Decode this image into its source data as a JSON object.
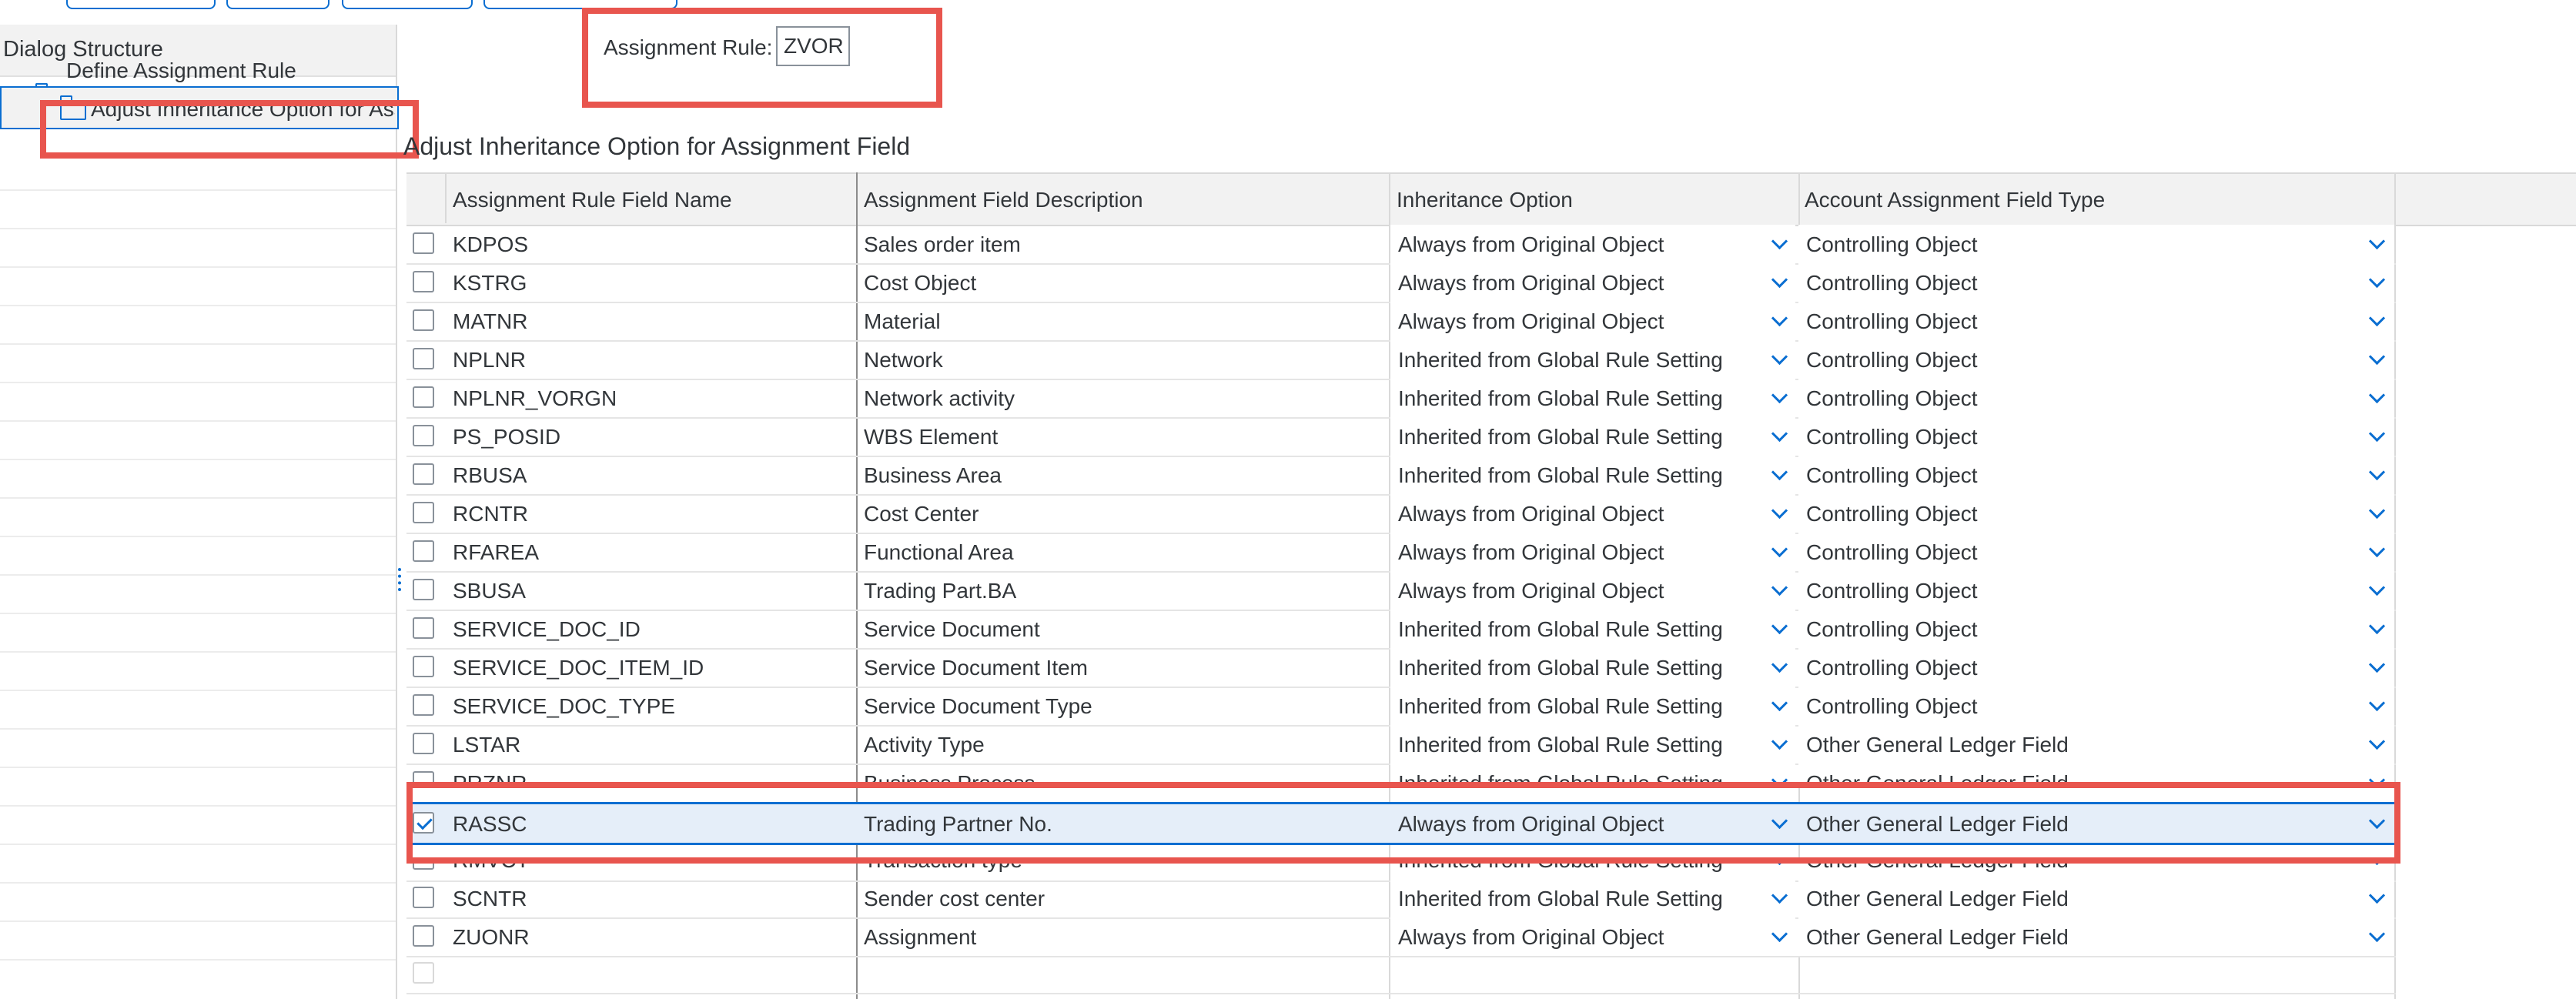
{
  "dialog": {
    "title": "Dialog Structure"
  },
  "tree": {
    "item1": "Define Assignment Rule",
    "item2": "Adjust Inheritance Option for Ass"
  },
  "assignment_rule": {
    "label": "Assignment Rule:",
    "value": "ZVOR"
  },
  "section_title": "Adjust Inheritance Option for Assignment Field",
  "table": {
    "headers": [
      "Assignment Rule Field Name",
      "Assignment Field Description",
      "Inheritance Option",
      "Account Assignment Field Type"
    ],
    "rows": [
      {
        "field": "KDPOS",
        "desc": "Sales order item",
        "option": "Always from Original Object",
        "type": "Controlling Object"
      },
      {
        "field": "KSTRG",
        "desc": "Cost Object",
        "option": "Always from Original Object",
        "type": "Controlling Object"
      },
      {
        "field": "MATNR",
        "desc": "Material",
        "option": "Always from Original Object",
        "type": "Controlling Object"
      },
      {
        "field": "NPLNR",
        "desc": "Network",
        "option": "Inherited from Global Rule Setting",
        "type": "Controlling Object"
      },
      {
        "field": "NPLNR_VORGN",
        "desc": "Network activity",
        "option": "Inherited from Global Rule Setting",
        "type": "Controlling Object"
      },
      {
        "field": "PS_POSID",
        "desc": "WBS Element",
        "option": "Inherited from Global Rule Setting",
        "type": "Controlling Object"
      },
      {
        "field": "RBUSA",
        "desc": "Business Area",
        "option": "Inherited from Global Rule Setting",
        "type": "Controlling Object"
      },
      {
        "field": "RCNTR",
        "desc": "Cost Center",
        "option": "Always from Original Object",
        "type": "Controlling Object"
      },
      {
        "field": "RFAREA",
        "desc": "Functional Area",
        "option": "Always from Original Object",
        "type": "Controlling Object"
      },
      {
        "field": "SBUSA",
        "desc": "Trading Part.BA",
        "option": "Always from Original Object",
        "type": "Controlling Object"
      },
      {
        "field": "SERVICE_DOC_ID",
        "desc": "Service Document",
        "option": "Inherited from Global Rule Setting",
        "type": "Controlling Object"
      },
      {
        "field": "SERVICE_DOC_ITEM_ID",
        "desc": "Service Document Item",
        "option": "Inherited from Global Rule Setting",
        "type": "Controlling Object"
      },
      {
        "field": "SERVICE_DOC_TYPE",
        "desc": "Service Document Type",
        "option": "Inherited from Global Rule Setting",
        "type": "Controlling Object"
      },
      {
        "field": "LSTAR",
        "desc": "Activity Type",
        "option": "Inherited from Global Rule Setting",
        "type": "Other General Ledger Field"
      },
      {
        "field": "PRZNR",
        "desc": "Business Process",
        "option": "Inherited from Global Rule Setting",
        "type": "Other General Ledger Field"
      },
      {
        "field": "RASSC",
        "desc": "Trading Partner No.",
        "option": "Always from Original Object",
        "type": "Other General Ledger Field"
      },
      {
        "field": "RMVCT",
        "desc": "Transaction type",
        "option": "Inherited from Global Rule Setting",
        "type": "Other General Ledger Field"
      },
      {
        "field": "SCNTR",
        "desc": "Sender cost center",
        "option": "Inherited from Global Rule Setting",
        "type": "Other General Ledger Field"
      },
      {
        "field": "ZUONR",
        "desc": "Assignment",
        "option": "Always from Original Object",
        "type": "Other General Ledger Field"
      }
    ]
  },
  "colors": {
    "accent": "#0a6ed1",
    "highlight": "#e8554e",
    "selected_row": "#e5eef9"
  }
}
